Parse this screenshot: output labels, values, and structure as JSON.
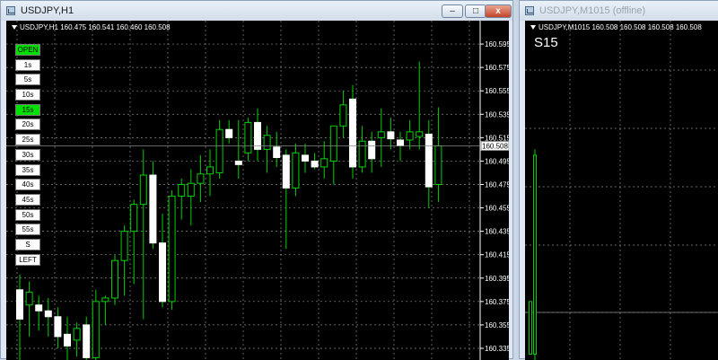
{
  "windows": {
    "left": {
      "title": "USDJPY,H1",
      "min_label": "–",
      "max_label": "□",
      "close_label": "x"
    },
    "right": {
      "title": "USDJPY,M1015 (offline)"
    }
  },
  "left_chart": {
    "header": "USDJPY,H1  160.475 160.541 160.460 160.508",
    "price_tag": "160.508",
    "timeframes": [
      {
        "label": "OPEN",
        "active": true
      },
      {
        "label": "1s",
        "active": false
      },
      {
        "label": "5s",
        "active": false
      },
      {
        "label": "10s",
        "active": false
      },
      {
        "label": "15s",
        "active": true
      },
      {
        "label": "20s",
        "active": false
      },
      {
        "label": "25s",
        "active": false
      },
      {
        "label": "30s",
        "active": false
      },
      {
        "label": "35s",
        "active": false
      },
      {
        "label": "40s",
        "active": false
      },
      {
        "label": "45s",
        "active": false
      },
      {
        "label": "50s",
        "active": false
      },
      {
        "label": "55s",
        "active": false
      },
      {
        "label": "S",
        "active": false
      },
      {
        "label": "LEFT",
        "active": false
      }
    ]
  },
  "right_chart": {
    "header": "USDJPY,M1015  160.508 160.508 160.508 160.508",
    "label": "S15"
  },
  "chart_data": {
    "type": "candlestick",
    "symbol": "USDJPY",
    "timeframe": "H1",
    "ylim": [
      160.325,
      160.615
    ],
    "y_ticks": [
      "160.595",
      "160.575",
      "160.555",
      "160.535",
      "160.515",
      "160.495",
      "160.475",
      "160.455",
      "160.435",
      "160.415",
      "160.395",
      "160.375",
      "160.355",
      "160.335"
    ],
    "last_price": 160.508,
    "candles": [
      {
        "o": 160.385,
        "h": 160.398,
        "l": 160.325,
        "c": 160.36
      },
      {
        "o": 160.372,
        "h": 160.392,
        "l": 160.345,
        "c": 160.383
      },
      {
        "o": 160.372,
        "h": 160.38,
        "l": 160.35,
        "c": 160.367
      },
      {
        "o": 160.367,
        "h": 160.378,
        "l": 160.345,
        "c": 160.362
      },
      {
        "o": 160.362,
        "h": 160.37,
        "l": 160.335,
        "c": 160.345
      },
      {
        "o": 160.347,
        "h": 160.362,
        "l": 160.325,
        "c": 160.337
      },
      {
        "o": 160.342,
        "h": 160.357,
        "l": 160.328,
        "c": 160.352
      },
      {
        "o": 160.355,
        "h": 160.362,
        "l": 160.32,
        "c": 160.327
      },
      {
        "o": 160.327,
        "h": 160.385,
        "l": 160.325,
        "c": 160.375
      },
      {
        "o": 160.375,
        "h": 160.38,
        "l": 160.355,
        "c": 160.378
      },
      {
        "o": 160.378,
        "h": 160.415,
        "l": 160.372,
        "c": 160.41
      },
      {
        "o": 160.41,
        "h": 160.44,
        "l": 160.38,
        "c": 160.435
      },
      {
        "o": 160.435,
        "h": 160.462,
        "l": 160.39,
        "c": 160.458
      },
      {
        "o": 160.458,
        "h": 160.505,
        "l": 160.36,
        "c": 160.483
      },
      {
        "o": 160.483,
        "h": 160.495,
        "l": 160.42,
        "c": 160.425
      },
      {
        "o": 160.425,
        "h": 160.45,
        "l": 160.37,
        "c": 160.375
      },
      {
        "o": 160.375,
        "h": 160.47,
        "l": 160.368,
        "c": 160.465
      },
      {
        "o": 160.465,
        "h": 160.48,
        "l": 160.445,
        "c": 160.475
      },
      {
        "o": 160.465,
        "h": 160.488,
        "l": 160.44,
        "c": 160.476
      },
      {
        "o": 160.476,
        "h": 160.5,
        "l": 160.46,
        "c": 160.484
      },
      {
        "o": 160.484,
        "h": 160.505,
        "l": 160.465,
        "c": 160.49
      },
      {
        "o": 160.485,
        "h": 160.53,
        "l": 160.48,
        "c": 160.522
      },
      {
        "o": 160.522,
        "h": 160.53,
        "l": 160.51,
        "c": 160.515
      },
      {
        "o": 160.495,
        "h": 160.53,
        "l": 160.48,
        "c": 160.492
      },
      {
        "o": 160.502,
        "h": 160.532,
        "l": 160.495,
        "c": 160.528
      },
      {
        "o": 160.528,
        "h": 160.54,
        "l": 160.495,
        "c": 160.505
      },
      {
        "o": 160.505,
        "h": 160.525,
        "l": 160.485,
        "c": 160.517
      },
      {
        "o": 160.507,
        "h": 160.52,
        "l": 160.49,
        "c": 160.498
      },
      {
        "o": 160.5,
        "h": 160.505,
        "l": 160.42,
        "c": 160.472
      },
      {
        "o": 160.472,
        "h": 160.51,
        "l": 160.465,
        "c": 160.502
      },
      {
        "o": 160.5,
        "h": 160.51,
        "l": 160.485,
        "c": 160.495
      },
      {
        "o": 160.495,
        "h": 160.502,
        "l": 160.488,
        "c": 160.49
      },
      {
        "o": 160.49,
        "h": 160.512,
        "l": 160.48,
        "c": 160.497
      },
      {
        "o": 160.495,
        "h": 160.525,
        "l": 160.475,
        "c": 160.525
      },
      {
        "o": 160.525,
        "h": 160.555,
        "l": 160.515,
        "c": 160.543
      },
      {
        "o": 160.548,
        "h": 160.56,
        "l": 160.48,
        "c": 160.49
      },
      {
        "o": 160.49,
        "h": 160.525,
        "l": 160.485,
        "c": 160.512
      },
      {
        "o": 160.512,
        "h": 160.52,
        "l": 160.485,
        "c": 160.497
      },
      {
        "o": 160.515,
        "h": 160.54,
        "l": 160.49,
        "c": 160.52
      },
      {
        "o": 160.52,
        "h": 160.532,
        "l": 160.505,
        "c": 160.514
      },
      {
        "o": 160.513,
        "h": 160.52,
        "l": 160.495,
        "c": 160.508
      },
      {
        "o": 160.513,
        "h": 160.53,
        "l": 160.505,
        "c": 160.52
      },
      {
        "o": 160.516,
        "h": 160.58,
        "l": 160.505,
        "c": 160.52
      },
      {
        "o": 160.518,
        "h": 160.53,
        "l": 160.455,
        "c": 160.473
      },
      {
        "o": 160.475,
        "h": 160.541,
        "l": 160.46,
        "c": 160.508
      }
    ]
  },
  "right_chart_data": {
    "type": "candlestick",
    "timeframe": "M1015",
    "candles": [
      {
        "o": 160.375,
        "h": 160.375,
        "l": 160.33,
        "c": 160.33
      },
      {
        "o": 160.33,
        "h": 160.505,
        "l": 160.325,
        "c": 160.5
      }
    ]
  }
}
